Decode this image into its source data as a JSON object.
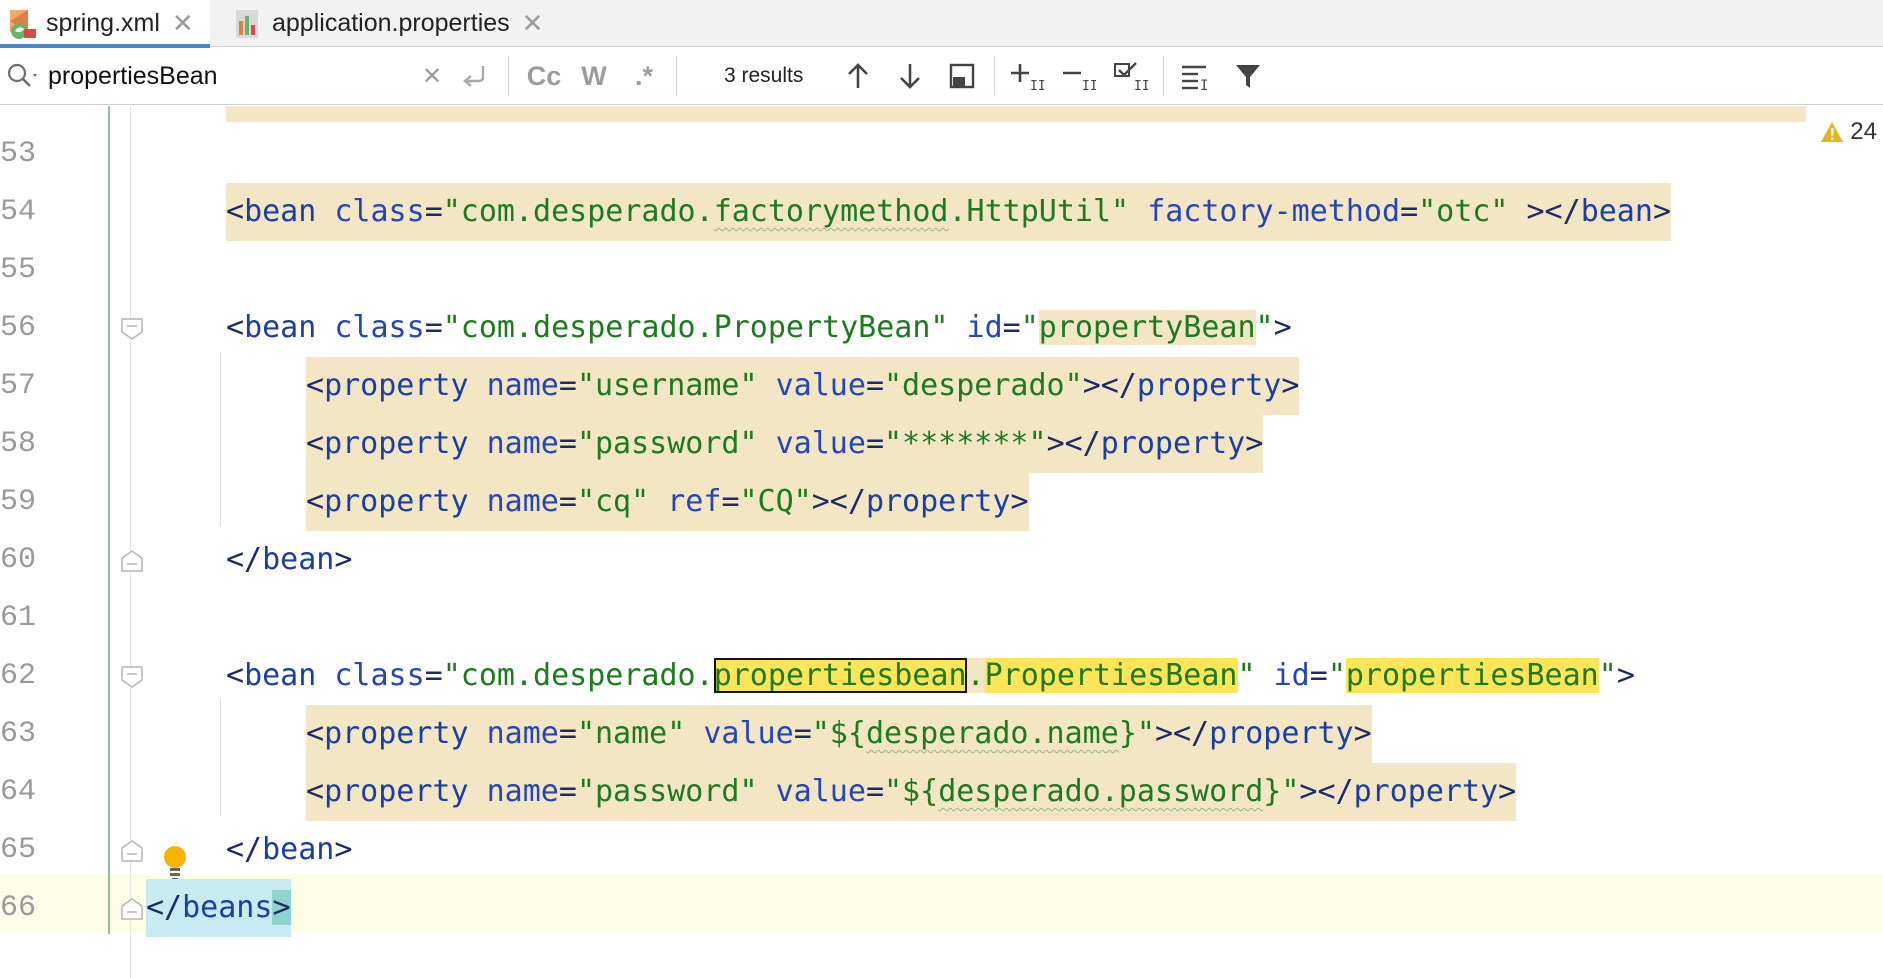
{
  "tabs": [
    {
      "label": "spring.xml",
      "active": true,
      "icon": "xml-spring-file-icon"
    },
    {
      "label": "application.properties",
      "active": false,
      "icon": "properties-file-icon"
    }
  ],
  "search": {
    "query": "propertiesBean",
    "match_case_label": "Cc",
    "words_label": "W",
    "regex_label": ".*",
    "results_label": "3 results"
  },
  "inspections": {
    "warning_count": "24",
    "warning_color": "#e8b224"
  },
  "editor": {
    "line_numbers": [
      "53",
      "54",
      "55",
      "56",
      "57",
      "58",
      "59",
      "60",
      "61",
      "62",
      "63",
      "64",
      "65",
      "66"
    ],
    "line54": {
      "open": "<",
      "tag": "bean",
      "sp1": " ",
      "attr1": "class",
      "eq1": "=",
      "val1_a": "\"com.desperado.",
      "val1_b": "factorymethod",
      "val1_c": ".HttpUtil\"",
      "sp2": " ",
      "attr2": "factory-method",
      "eq2": "=",
      "val2": "\"otc\"",
      "close": " ></",
      "tag2": "bean",
      "end": ">"
    },
    "line56": {
      "open": "<",
      "tag": "bean",
      "sp1": " ",
      "attr1": "class",
      "eq1": "=",
      "val1": "\"com.desperado.PropertyBean\"",
      "sp2": " ",
      "attr2": "id",
      "eq2": "=",
      "val2_q": "\"",
      "val2": "propertyBean",
      "val2_q2": "\"",
      "end": ">"
    },
    "line57": {
      "open": "<",
      "tag": "property",
      "sp1": " ",
      "attr1": "name",
      "eq1": "=",
      "val1": "\"username\"",
      "sp2": " ",
      "attr2": "value",
      "eq2": "=",
      "val2": "\"desperado\"",
      "close": "></",
      "tag2": "property",
      "end": ">"
    },
    "line58": {
      "open": "<",
      "tag": "property",
      "sp1": " ",
      "attr1": "name",
      "eq1": "=",
      "val1": "\"password\"",
      "sp2": " ",
      "attr2": "value",
      "eq2": "=",
      "val2": "\"*******\"",
      "close": "></",
      "tag2": "property",
      "end": ">"
    },
    "line59": {
      "open": "<",
      "tag": "property",
      "sp1": " ",
      "attr1": "name",
      "eq1": "=",
      "val1": "\"cq\"",
      "sp2": " ",
      "attr2": "ref",
      "eq2": "=",
      "val2": "\"CQ\"",
      "close": "></",
      "tag2": "property",
      "end": ">"
    },
    "line60": {
      "open": "</",
      "tag": "bean",
      "end": ">"
    },
    "line62": {
      "open": "<",
      "tag": "bean",
      "sp1": " ",
      "attr1": "class",
      "eq1": "=",
      "val1_a": "\"com.desperado.",
      "match1": "propertiesbean",
      "dot": ".",
      "match2": "PropertiesBean",
      "val1_q": "\"",
      "sp2": " ",
      "attr2": "id",
      "eq2": "=",
      "val2_q": "\"",
      "match3": "propertiesBean",
      "val2_q2": "\"",
      "end": ">"
    },
    "line63": {
      "open": "<",
      "tag": "property",
      "sp1": " ",
      "attr1": "name",
      "eq1": "=",
      "val1": "\"name\"",
      "sp2": " ",
      "attr2": "value",
      "eq2": "=",
      "val2_a": "\"${",
      "val2_b": "desperado.name",
      "val2_c": "}\"",
      "close": "></",
      "tag2": "property",
      "end": ">"
    },
    "line64": {
      "open": "<",
      "tag": "property",
      "sp1": " ",
      "attr1": "name",
      "eq1": "=",
      "val1": "\"password\"",
      "sp2": " ",
      "attr2": "value",
      "eq2": "=",
      "val2_a": "\"${",
      "val2_b": "desperado.password",
      "val2_c": "}\"",
      "close": "></",
      "tag2": "property",
      "end": ">"
    },
    "line65": {
      "open": "</",
      "tag": "bean",
      "end": ">"
    },
    "line66": {
      "open": "</",
      "tag": "beans",
      "end": ">"
    }
  }
}
